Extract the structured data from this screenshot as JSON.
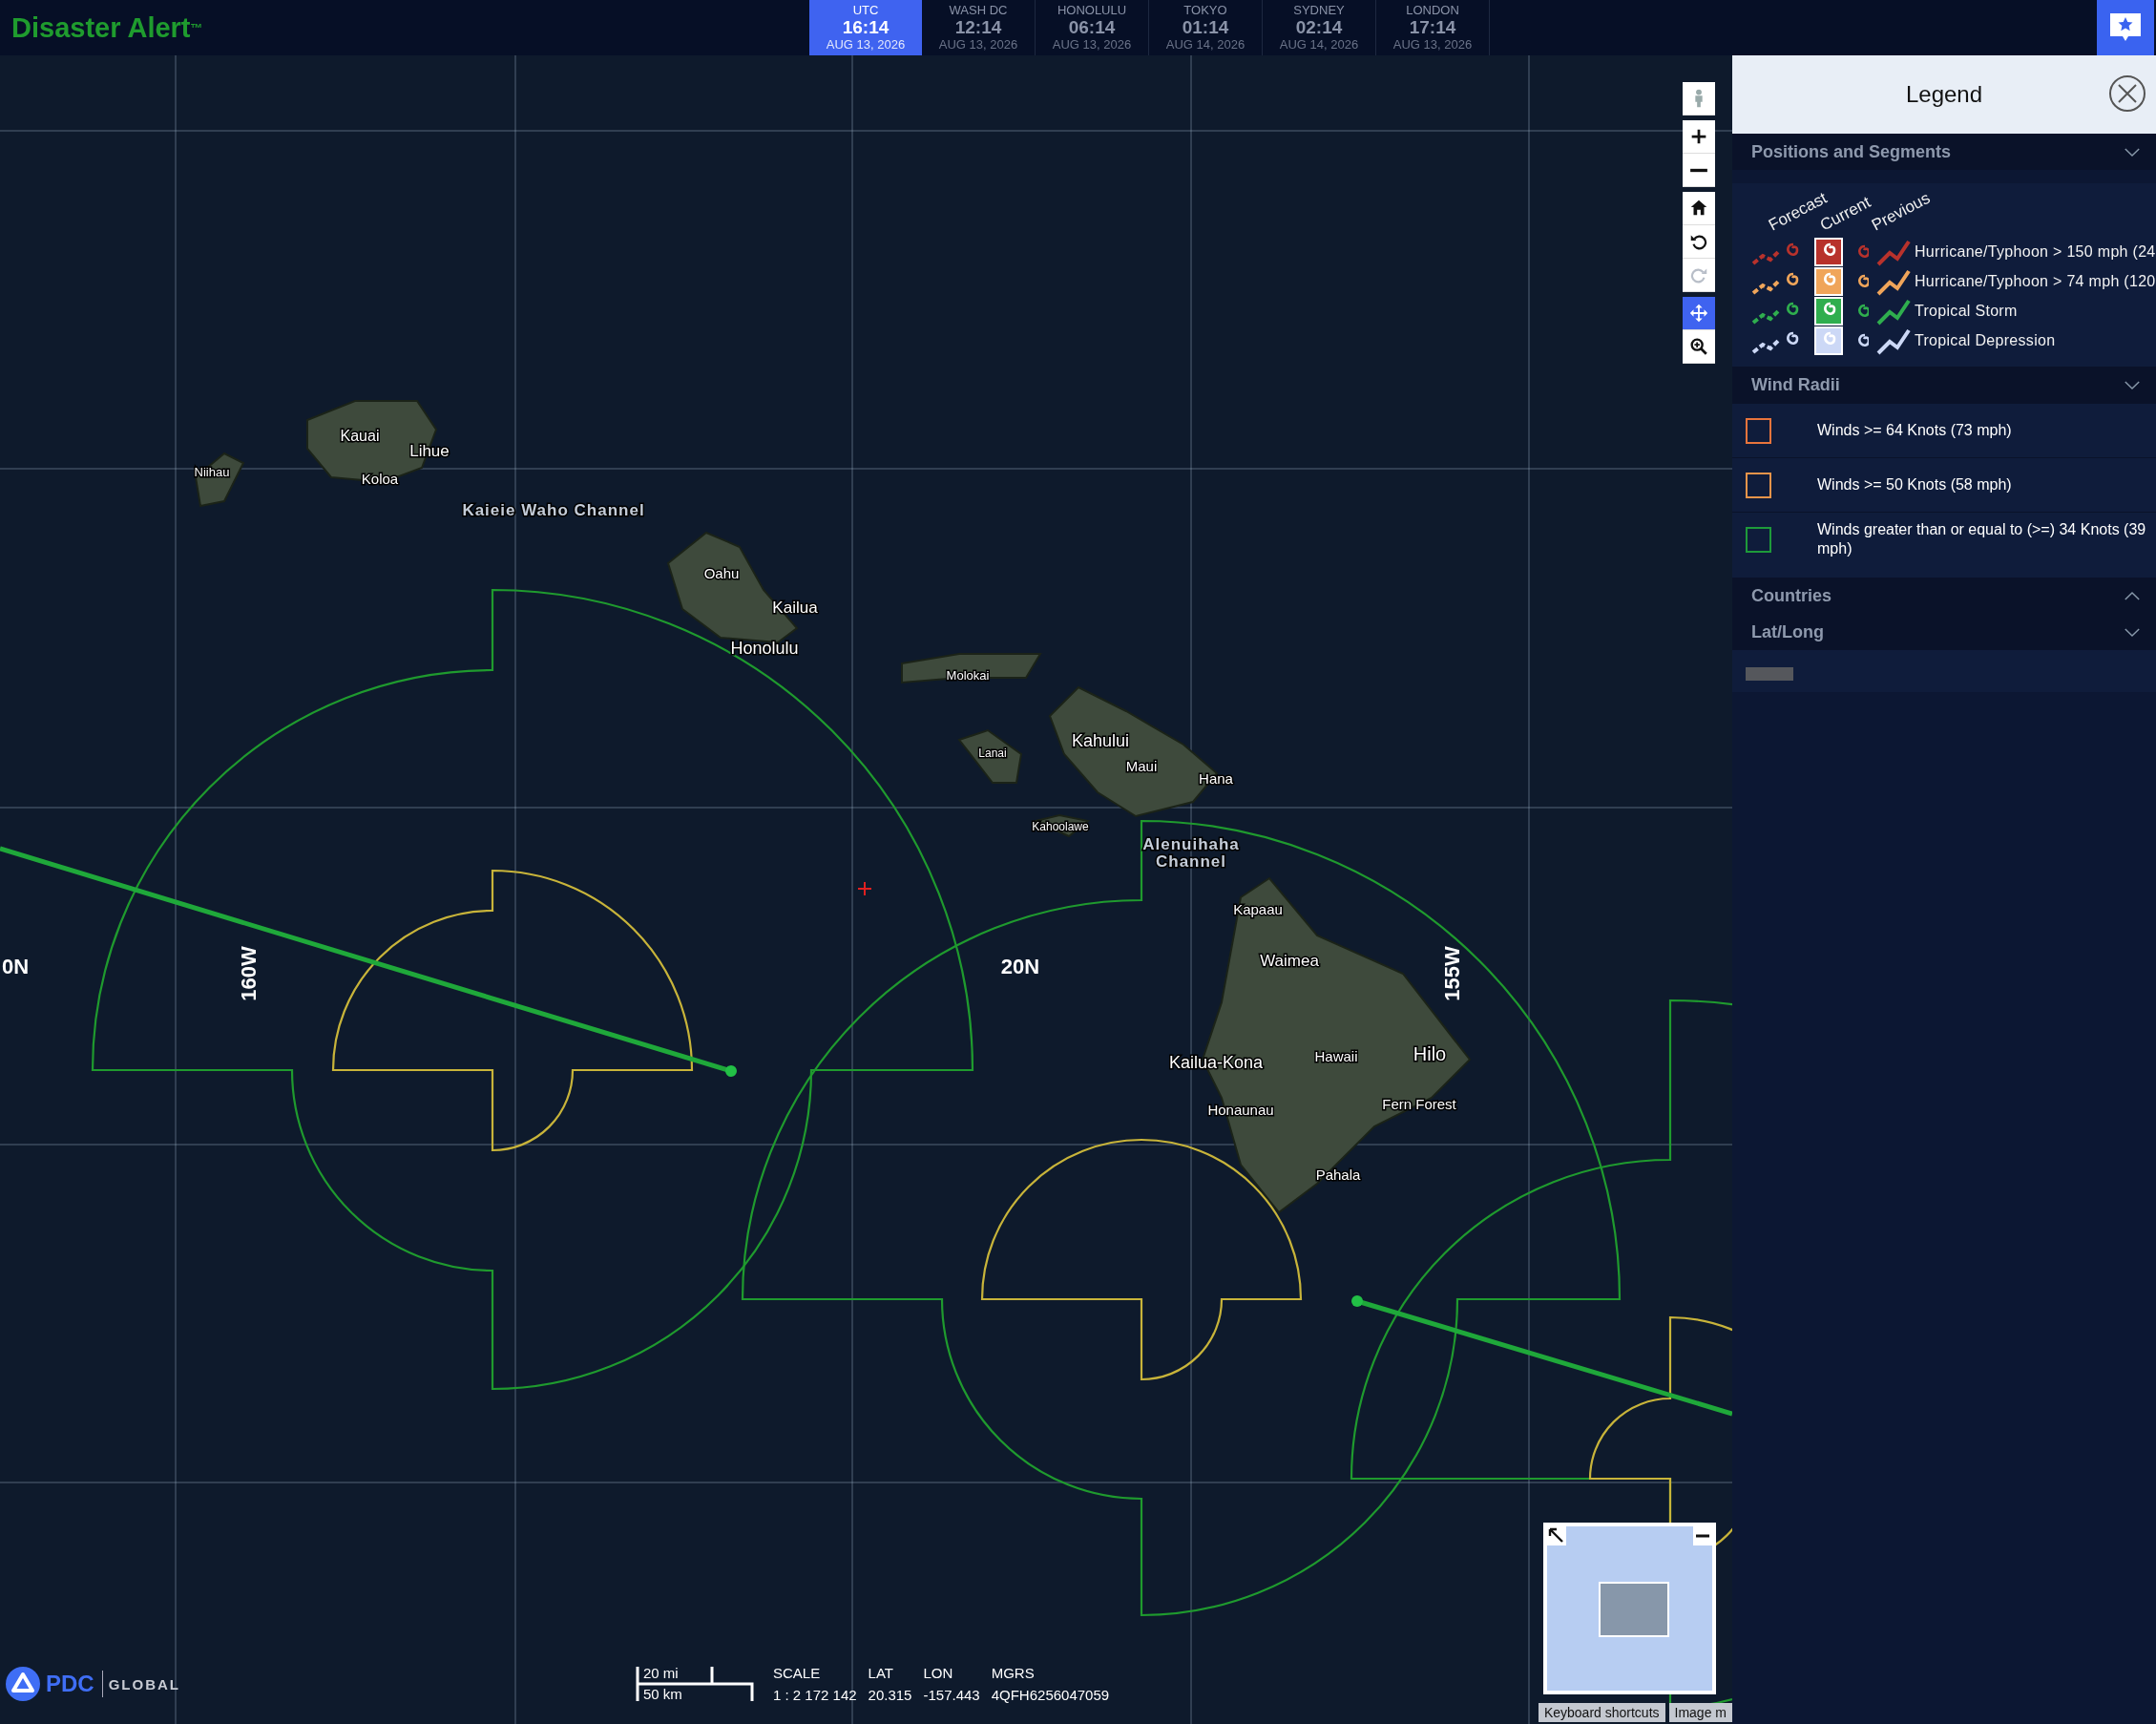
{
  "header": {
    "logo": "Disaster Alert$^{™}$",
    "clocks": [
      {
        "city": "UTC",
        "time": "16:14",
        "date": "AUG 13, 2026",
        "selected": true
      },
      {
        "city": "WASH DC",
        "time": "12:14",
        "date": "AUG 13, 2026",
        "selected": false
      },
      {
        "city": "HONOLULU",
        "time": "06:14",
        "date": "AUG 13, 2026",
        "selected": false
      },
      {
        "city": "TOKYO",
        "time": "01:14",
        "date": "AUG 14, 2026",
        "selected": false
      },
      {
        "city": "SYDNEY",
        "time": "02:14",
        "date": "AUG 14, 2026",
        "selected": false
      },
      {
        "city": "LONDON",
        "time": "17:14",
        "date": "AUG 13, 2026",
        "selected": false
      }
    ]
  },
  "map": {
    "labels": [
      {
        "text": "Niihau",
        "kind": "place"
      },
      {
        "text": "Kauai",
        "kind": "place"
      },
      {
        "text": "Lihue",
        "kind": "place"
      },
      {
        "text": "Koloa",
        "kind": "place"
      },
      {
        "text": "Kaieie Waho Channel",
        "kind": "channel"
      },
      {
        "text": "Oahu",
        "kind": "place"
      },
      {
        "text": "Kailua",
        "kind": "place"
      },
      {
        "text": "Honolulu",
        "kind": "place"
      },
      {
        "text": "Molokai",
        "kind": "place"
      },
      {
        "text": "Lanai",
        "kind": "place"
      },
      {
        "text": "Kahului",
        "kind": "place"
      },
      {
        "text": "Maui",
        "kind": "place"
      },
      {
        "text": "Hana",
        "kind": "place"
      },
      {
        "text": "Kahoolawe",
        "kind": "place"
      },
      {
        "text": "Alenuihaha Channel",
        "kind": "channel"
      },
      {
        "text": "Kapaau",
        "kind": "place"
      },
      {
        "text": "Waimea",
        "kind": "place"
      },
      {
        "text": "Kailua-Kona",
        "kind": "place"
      },
      {
        "text": "Hawaii",
        "kind": "place"
      },
      {
        "text": "Hilo",
        "kind": "place"
      },
      {
        "text": "Honaunau",
        "kind": "place"
      },
      {
        "text": "Fern Forest",
        "kind": "place"
      },
      {
        "text": "Pahala",
        "kind": "place"
      }
    ],
    "grid_labels": [
      {
        "text": "0N",
        "kind": "lat"
      },
      {
        "text": "160W",
        "kind": "lon"
      },
      {
        "text": "20N",
        "kind": "lat"
      },
      {
        "text": "155W",
        "kind": "lon"
      }
    ],
    "tools": [
      {
        "kind": "person",
        "selected": false
      },
      {
        "kind": "zoom-in",
        "selected": false
      },
      {
        "kind": "zoom-out",
        "selected": false
      },
      {
        "kind": "home",
        "selected": false
      },
      {
        "kind": "rotate-left",
        "selected": false
      },
      {
        "kind": "rotate-right",
        "selected": false,
        "disabled": true
      },
      {
        "kind": "pan",
        "selected": true
      },
      {
        "kind": "zoom-box",
        "selected": false
      }
    ],
    "brand": {
      "name": "PDC",
      "suffix": "GLOBAL"
    },
    "scale_bar": {
      "miles": "20 mi",
      "kilometers": "50 km"
    },
    "readouts": [
      {
        "label": "SCALE",
        "value": "1 : 2 172 142"
      },
      {
        "label": "LAT",
        "value": "20.315"
      },
      {
        "label": "LON",
        "value": "-157.443"
      },
      {
        "label": "MGRS",
        "value": "4QFH6256047059"
      }
    ],
    "attribution": [
      "Keyboard shortcuts",
      "Image m"
    ]
  },
  "legend": {
    "title": "Legend",
    "sections": [
      {
        "title": "Positions and Segments",
        "kind": "positions",
        "expanded": true,
        "columns": [
          "Forecast",
          "Current",
          "Previous"
        ],
        "items": [
          {
            "label": "Hurricane/Typhoon > 150 mph (24",
            "color": "#b8322c"
          },
          {
            "label": "Hurricane/Typhoon > 74 mph (120",
            "color": "#f0a55a"
          },
          {
            "label": "Tropical Storm",
            "color": "#2fae4e"
          },
          {
            "label": "Tropical Depression",
            "color": "#ccd8f6"
          }
        ]
      },
      {
        "title": "Wind Radii",
        "kind": "radii",
        "expanded": true,
        "items": [
          {
            "label": "Winds >= 64 Knots (73 mph)",
            "color": "#e8743c"
          },
          {
            "label": "Winds >= 50 Knots (58 mph)",
            "color": "#e8944a"
          },
          {
            "label": "Winds greater than or equal to (>=) 34 Knots (39 mph)",
            "color": "#1e9a3a"
          }
        ]
      },
      {
        "title": "Countries",
        "expanded": false
      },
      {
        "title": "Lat/Long",
        "kind": "latlong",
        "expanded": true
      }
    ]
  }
}
